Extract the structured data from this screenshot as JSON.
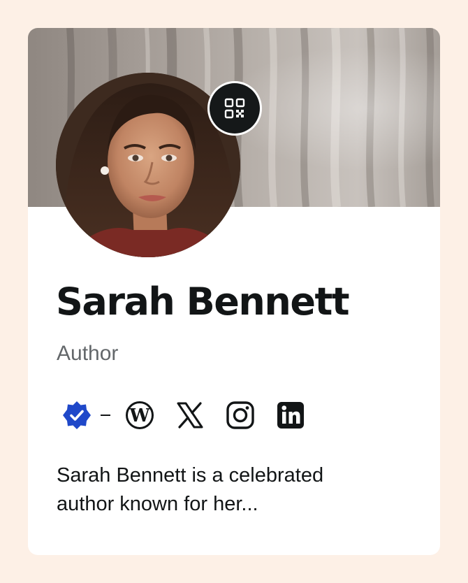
{
  "profile": {
    "name": "Sarah Bennett",
    "role": "Author",
    "bio": "Sarah Bennett is a celebrated author known for her..."
  },
  "icons": {
    "qr": "qr-code-icon",
    "verified": "verified-badge-icon",
    "links": [
      "wordpress-icon",
      "x-icon",
      "instagram-icon",
      "linkedin-icon"
    ]
  },
  "colors": {
    "page_background": "#fdf0e6",
    "card_background": "#ffffff",
    "text_primary": "#121516",
    "text_secondary": "#63676a",
    "verified_blue": "#1f48c9",
    "dark_button": "#151819"
  }
}
